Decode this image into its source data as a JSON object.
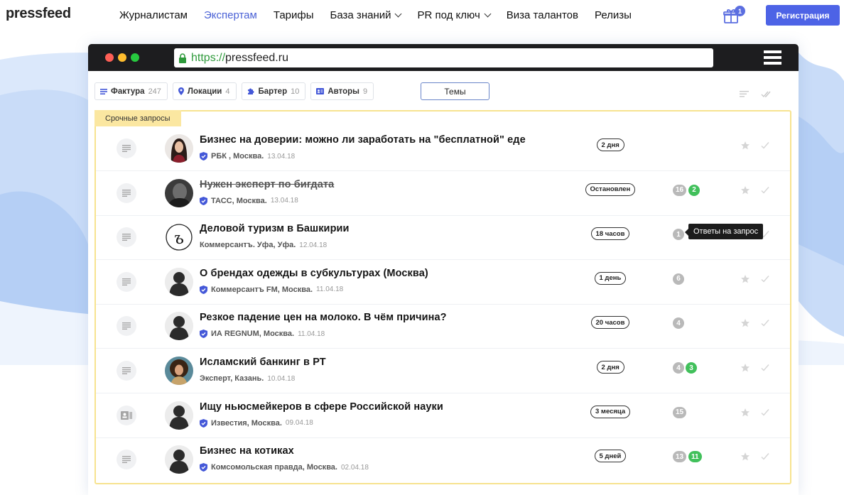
{
  "site": {
    "logo": "pressfeed",
    "nav": [
      {
        "label": "Журналистам",
        "active": false,
        "dropdown": false
      },
      {
        "label": "Экспертам",
        "active": true,
        "dropdown": false
      },
      {
        "label": "Тарифы",
        "active": false,
        "dropdown": false
      },
      {
        "label": "База знаний",
        "active": false,
        "dropdown": true
      },
      {
        "label": "PR под ключ",
        "active": false,
        "dropdown": true
      },
      {
        "label": "Виза талантов",
        "active": false,
        "dropdown": false
      },
      {
        "label": "Релизы",
        "active": false,
        "dropdown": false
      }
    ],
    "gift_count": "1",
    "register_label": "Регистрация"
  },
  "browser": {
    "url_scheme": "https://",
    "url_host": "pressfeed.ru"
  },
  "filters": [
    {
      "label": "Фактура",
      "count": "247",
      "icon": "lines-icon"
    },
    {
      "label": "Локации",
      "count": "4",
      "icon": "pin-icon"
    },
    {
      "label": "Бартер",
      "count": "10",
      "icon": "puzzle-icon"
    },
    {
      "label": "Авторы",
      "count": "9",
      "icon": "id-card-icon"
    }
  ],
  "themes_label": "Темы",
  "urgent_label": "Срочные запросы",
  "tooltip": "Ответы на запрос",
  "requests": [
    {
      "title": "Бизнес на доверии: можно ли заработать на \"бесплатной\" еде",
      "source": "РБК , Москва.",
      "date": "13.04.18",
      "verified": true,
      "deadline": "2 дня",
      "answers": "",
      "green": "",
      "avatar": "woman-dark-hair",
      "type_icon": "text-icon",
      "struck": false
    },
    {
      "title": "Нужен эксперт по бигдата",
      "source": "ТАСС, Москва.",
      "date": "13.04.18",
      "verified": true,
      "deadline": "Остановлен",
      "answers": "16",
      "green": "2",
      "avatar": "man-dark-photo",
      "type_icon": "text-icon",
      "struck": true
    },
    {
      "title": "Деловой туризм в Башкирии",
      "source": "Коммерсантъ. Уфа, Уфа.",
      "date": "12.04.18",
      "verified": false,
      "deadline": "18 часов",
      "answers": "1",
      "green": "",
      "avatar": "kommersant-logo",
      "type_icon": "text-icon",
      "struck": false
    },
    {
      "title": "О брендах одежды в субкультурах (Москва)",
      "source": "Коммерсантъ FM, Москва.",
      "date": "11.04.18",
      "verified": true,
      "deadline": "1 день",
      "answers": "6",
      "green": "",
      "avatar": "silhouette",
      "type_icon": "text-icon",
      "struck": false
    },
    {
      "title": "Резкое падение цен на молоко. В чём причина?",
      "source": "ИА REGNUM, Москва.",
      "date": "11.04.18",
      "verified": true,
      "deadline": "20 часов",
      "answers": "4",
      "green": "",
      "avatar": "silhouette",
      "type_icon": "text-icon",
      "struck": false
    },
    {
      "title": "Исламский банкинг в РТ",
      "source": "Эксперт, Казань.",
      "date": "10.04.18",
      "verified": false,
      "deadline": "2 дня",
      "answers": "4",
      "green": "3",
      "avatar": "woman-curly-hair",
      "type_icon": "text-icon",
      "struck": false
    },
    {
      "title": "Ищу ньюсмейкеров в сфере Российской науки",
      "source": "Известия, Москва.",
      "date": "09.04.18",
      "verified": true,
      "deadline": "3 месяца",
      "answers": "15",
      "green": "",
      "avatar": "silhouette",
      "type_icon": "id-card-icon",
      "struck": false
    },
    {
      "title": "Бизнес на котиках",
      "source": "Комсомольская правда, Москва.",
      "date": "02.04.18",
      "verified": true,
      "deadline": "5 дней",
      "answers": "13",
      "green": "11",
      "avatar": "silhouette",
      "type_icon": "text-icon",
      "struck": false
    }
  ],
  "colors": {
    "brand": "#4d63e6",
    "accent_link": "#4b62d6",
    "urgent_border": "#f7e38f",
    "green_count": "#41c05b",
    "verified": "#4458d8"
  }
}
